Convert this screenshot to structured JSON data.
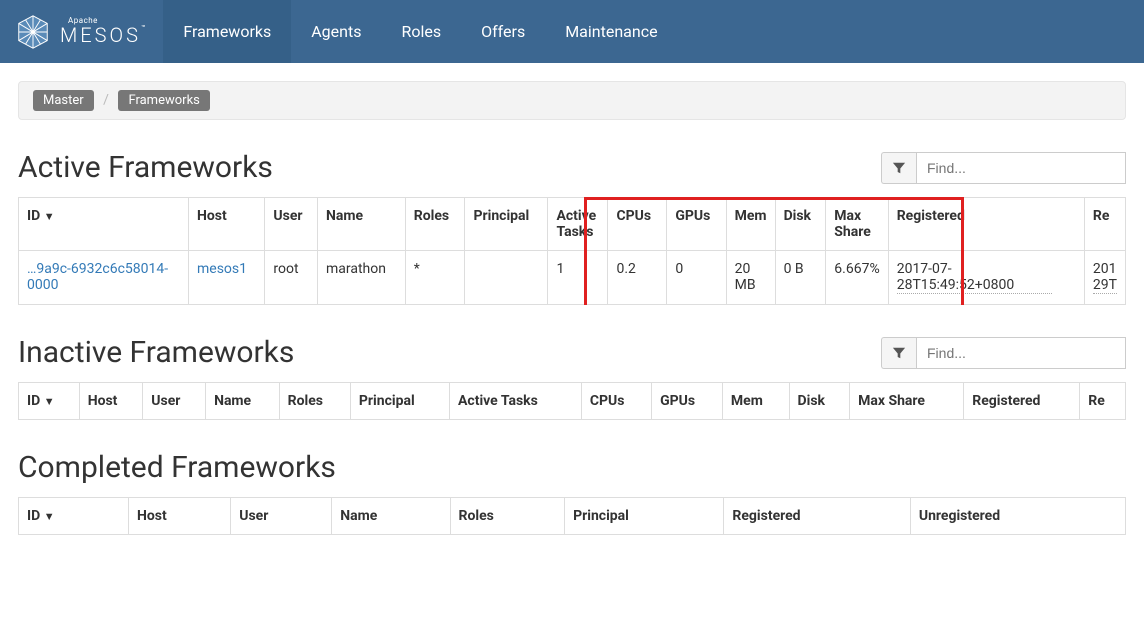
{
  "brand": {
    "apache": "Apache",
    "name": "MESOS",
    "tm": "™"
  },
  "nav": {
    "items": [
      {
        "label": "Frameworks",
        "active": true
      },
      {
        "label": "Agents",
        "active": false
      },
      {
        "label": "Roles",
        "active": false
      },
      {
        "label": "Offers",
        "active": false
      },
      {
        "label": "Maintenance",
        "active": false
      }
    ]
  },
  "breadcrumbs": {
    "master": "Master",
    "frameworks": "Frameworks"
  },
  "filter": {
    "placeholder": "Find..."
  },
  "sections": {
    "active": {
      "title": "Active Frameworks",
      "columns": [
        "ID",
        "Host",
        "User",
        "Name",
        "Roles",
        "Principal",
        "Active Tasks",
        "CPUs",
        "GPUs",
        "Mem",
        "Disk",
        "Max Share",
        "Registered",
        "Re"
      ],
      "sort_arrow": "▼",
      "rows": [
        {
          "id": "…9a9c-6932c6c58014-0000",
          "host": "mesos1",
          "user": "root",
          "name": "marathon",
          "roles": "*",
          "principal": "",
          "active_tasks": "1",
          "cpus": "0.2",
          "gpus": "0",
          "mem": "20 MB",
          "disk": "0 B",
          "max_share": "6.667%",
          "registered": "2017-07-28T15:49:52+0800",
          "re": "201\n29T"
        }
      ]
    },
    "inactive": {
      "title": "Inactive Frameworks",
      "columns": [
        "ID",
        "Host",
        "User",
        "Name",
        "Roles",
        "Principal",
        "Active Tasks",
        "CPUs",
        "GPUs",
        "Mem",
        "Disk",
        "Max Share",
        "Registered",
        "Re"
      ],
      "sort_arrow": "▼"
    },
    "completed": {
      "title": "Completed Frameworks",
      "columns": [
        "ID",
        "Host",
        "User",
        "Name",
        "Roles",
        "Principal",
        "Registered",
        "Unregistered"
      ],
      "sort_arrow": "▼"
    }
  }
}
